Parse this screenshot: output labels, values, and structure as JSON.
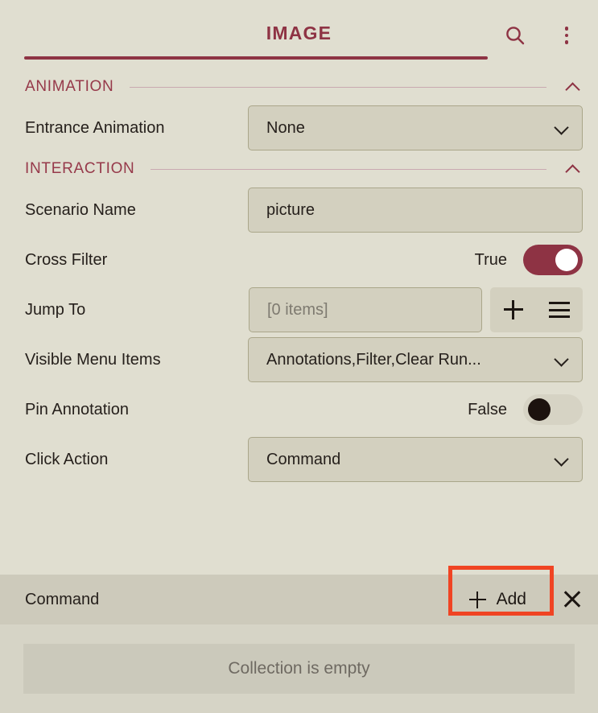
{
  "header": {
    "title": "IMAGE",
    "search_icon": "search-icon",
    "menu_icon": "more-vertical-icon"
  },
  "sections": [
    {
      "title": "ANIMATION",
      "collapse_icon": "chevron-up-icon",
      "rows": [
        {
          "label": "Entrance Animation",
          "type": "dropdown",
          "value": "None"
        }
      ]
    },
    {
      "title": "INTERACTION",
      "collapse_icon": "chevron-up-icon",
      "rows": [
        {
          "label": "Scenario Name",
          "type": "text",
          "value": "picture"
        },
        {
          "label": "Cross Filter",
          "type": "toggle",
          "value": "True",
          "state": "on"
        },
        {
          "label": "Jump To",
          "type": "collection",
          "value": "[0 items]",
          "add_icon": "plus-icon",
          "list_icon": "hamburger-icon"
        },
        {
          "label": "Visible Menu Items",
          "type": "dropdown",
          "value": "Annotations,Filter,Clear Run..."
        },
        {
          "label": "Pin Annotation",
          "type": "toggle",
          "value": "False",
          "state": "off"
        },
        {
          "label": "Click Action",
          "type": "dropdown",
          "value": "Command"
        }
      ]
    }
  ],
  "command_band": {
    "label": "Command",
    "add_label": "Add",
    "add_icon": "plus-icon",
    "close_icon": "close-icon",
    "highlight_color": "#f04423"
  },
  "collection": {
    "empty_text": "Collection is empty"
  },
  "colors": {
    "background": "#e0ded0",
    "accent": "#8e3344",
    "field_fill": "#d3d0bf",
    "field_border": "#aaa68a",
    "band": "#cdcabb",
    "highlight": "#f04423"
  }
}
